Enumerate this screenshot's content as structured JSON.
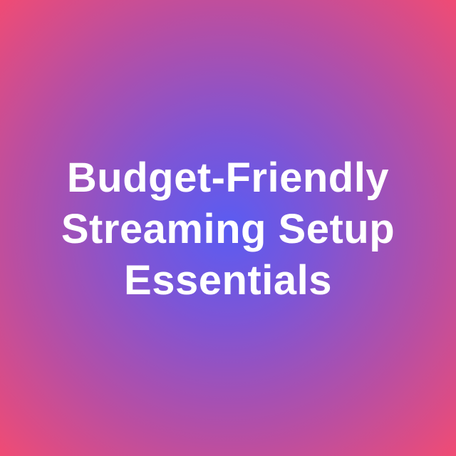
{
  "title": {
    "line1": "Budget-Friendly",
    "line2": "Streaming Setup",
    "line3": "Essentials"
  },
  "colors": {
    "background_center": "#5a5cf2",
    "background_mid": "#b24fa8",
    "background_edge": "#f04b74",
    "text": "#ffffff"
  }
}
